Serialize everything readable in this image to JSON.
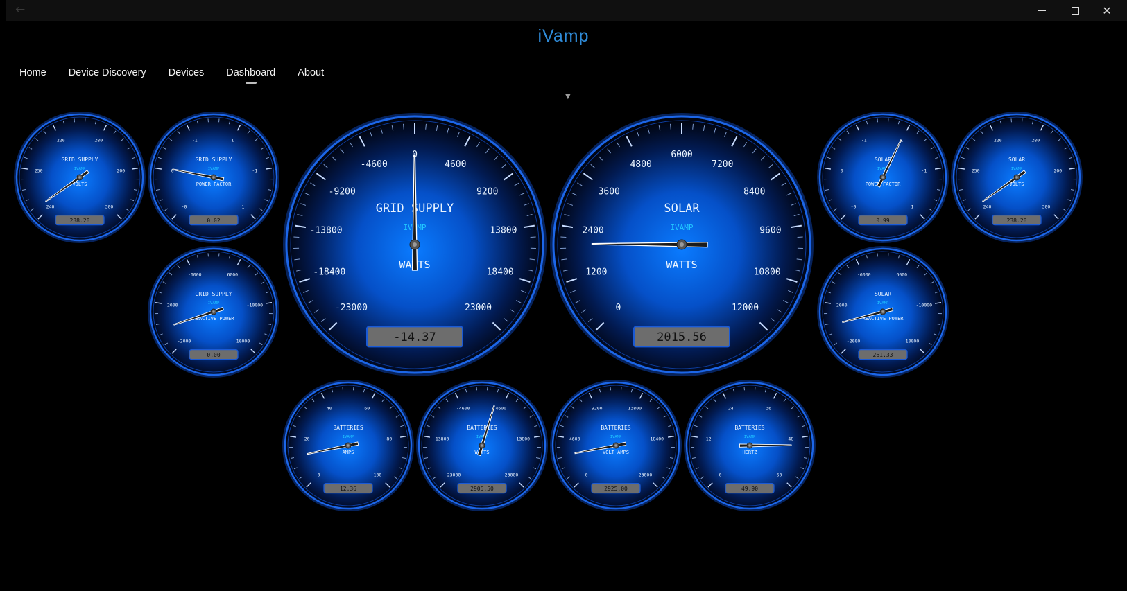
{
  "window": {
    "back_icon": "back-arrow-icon",
    "minimize_icon": "minimize-icon",
    "maximize_icon": "maximize-icon",
    "close_icon": "close-icon"
  },
  "app": {
    "title": "iVamp"
  },
  "nav": {
    "items": [
      {
        "label": "Home",
        "active": false
      },
      {
        "label": "Device Discovery",
        "active": false
      },
      {
        "label": "Devices",
        "active": false
      },
      {
        "label": "Dashboard",
        "active": true
      },
      {
        "label": "About",
        "active": false
      }
    ]
  },
  "expander": {
    "glyph": "▼",
    "icon": "chevron-down-icon"
  },
  "colors": {
    "accent": "#2f8bd8",
    "gauge_rim": "#1c66e8",
    "gauge_center": "#0a7bff",
    "brand": "#21c6ff"
  },
  "gauges": [
    {
      "id": "grid-voltage",
      "size": "small",
      "title": "GRID SUPPLY",
      "brand": "IVAMP",
      "unit": "VOLTS",
      "reading": "238.20",
      "value": 238.2,
      "scale": [
        {
          "label": "240",
          "value": 240
        },
        {
          "label": "250",
          "value": 250
        },
        {
          "label": "220",
          "value": 220
        },
        {
          "label": "280",
          "value": 280
        },
        {
          "label": "200",
          "value": 200
        },
        {
          "label": "300",
          "value": 300
        }
      ]
    },
    {
      "id": "grid-power-factor",
      "size": "small",
      "title": "GRID SUPPLY",
      "brand": "IVAMP",
      "unit": "POWER FACTOR",
      "reading": "0.02",
      "value": 0.02,
      "scale": [
        {
          "label": "-0",
          "value": -0.001
        },
        {
          "label": "0",
          "value": 0.001
        },
        {
          "label": "-1",
          "value": -1
        },
        {
          "label": "1",
          "value": 1
        },
        {
          "label": "-1",
          "value": -2
        },
        {
          "label": "1",
          "value": 2
        }
      ]
    },
    {
      "id": "grid-reactive-power",
      "size": "small",
      "title": "GRID SUPPLY",
      "brand": "IVAMP",
      "unit": "REACTIVE POWER",
      "reading": "0.00",
      "value": 0,
      "scale": [
        {
          "label": "-2000",
          "value": -2000
        },
        {
          "label": "2000",
          "value": 2000
        },
        {
          "label": "-6000",
          "value": -6000
        },
        {
          "label": "6000",
          "value": 6000
        },
        {
          "label": "-10000",
          "value": -10000
        },
        {
          "label": "10000",
          "value": 10000
        }
      ]
    },
    {
      "id": "grid-watts",
      "size": "large",
      "title": "GRID SUPPLY",
      "brand": "IVAMP",
      "unit": "WATTS",
      "reading": "-14.37",
      "value": -14.37,
      "scale": [
        {
          "label": "-23000",
          "value": -23000
        },
        {
          "label": "-18400",
          "value": -18400
        },
        {
          "label": "-13800",
          "value": -13800
        },
        {
          "label": "-9200",
          "value": -9200
        },
        {
          "label": "-4600",
          "value": -4600
        },
        {
          "label": "0",
          "value": 0
        },
        {
          "label": "4600",
          "value": 4600
        },
        {
          "label": "9200",
          "value": 9200
        },
        {
          "label": "13800",
          "value": 13800
        },
        {
          "label": "18400",
          "value": 18400
        },
        {
          "label": "23000",
          "value": 23000
        }
      ]
    },
    {
      "id": "solar-watts",
      "size": "large",
      "title": "SOLAR",
      "brand": "IVAMP",
      "unit": "WATTS",
      "reading": "2015.56",
      "value": 2015.56,
      "scale": [
        {
          "label": "0",
          "value": 0
        },
        {
          "label": "1200",
          "value": 1200
        },
        {
          "label": "2400",
          "value": 2400
        },
        {
          "label": "3600",
          "value": 3600
        },
        {
          "label": "4800",
          "value": 4800
        },
        {
          "label": "6000",
          "value": 6000
        },
        {
          "label": "7200",
          "value": 7200
        },
        {
          "label": "8400",
          "value": 8400
        },
        {
          "label": "9600",
          "value": 9600
        },
        {
          "label": "10800",
          "value": 10800
        },
        {
          "label": "12000",
          "value": 12000
        }
      ]
    },
    {
      "id": "solar-power-factor",
      "size": "small",
      "title": "SOLAR",
      "brand": "IVAMP",
      "unit": "POWER FACTOR",
      "reading": "0.99",
      "value": 0.99,
      "scale": [
        {
          "label": "-0",
          "value": -0.001
        },
        {
          "label": "0",
          "value": 0.001
        },
        {
          "label": "-1",
          "value": -1
        },
        {
          "label": "1",
          "value": 1
        },
        {
          "label": "-1",
          "value": -2
        },
        {
          "label": "1",
          "value": 2
        }
      ]
    },
    {
      "id": "solar-voltage",
      "size": "small",
      "title": "SOLAR",
      "brand": "IVAMP",
      "unit": "VOLTS",
      "reading": "238.20",
      "value": 238.2,
      "scale": [
        {
          "label": "240",
          "value": 240
        },
        {
          "label": "250",
          "value": 250
        },
        {
          "label": "220",
          "value": 220
        },
        {
          "label": "280",
          "value": 280
        },
        {
          "label": "200",
          "value": 200
        },
        {
          "label": "300",
          "value": 300
        }
      ]
    },
    {
      "id": "solar-reactive-power",
      "size": "small",
      "title": "SOLAR",
      "brand": "IVAMP",
      "unit": "REACTIVE POWER",
      "reading": "261.33",
      "value": 261.33,
      "scale": [
        {
          "label": "-2000",
          "value": -2000
        },
        {
          "label": "2000",
          "value": 2000
        },
        {
          "label": "-6000",
          "value": -6000
        },
        {
          "label": "6000",
          "value": 6000
        },
        {
          "label": "-10000",
          "value": -10000
        },
        {
          "label": "10000",
          "value": 10000
        }
      ]
    },
    {
      "id": "batteries-amps",
      "size": "small",
      "title": "BATTERIES",
      "brand": "IVAMP",
      "unit": "AMPS",
      "reading": "12.36",
      "value": 12.36,
      "scale": [
        {
          "label": "0",
          "value": 0
        },
        {
          "label": "20",
          "value": 20
        },
        {
          "label": "40",
          "value": 40
        },
        {
          "label": "60",
          "value": 60
        },
        {
          "label": "80",
          "value": 80
        },
        {
          "label": "100",
          "value": 100
        }
      ]
    },
    {
      "id": "batteries-watts",
      "size": "small",
      "title": "BATTERIES",
      "brand": "IVAMP",
      "unit": "WATTS",
      "reading": "2905.50",
      "value": 2905.5,
      "scale": [
        {
          "label": "-23000",
          "value": -23000
        },
        {
          "label": "-13800",
          "value": -13800
        },
        {
          "label": "-4600",
          "value": -4600
        },
        {
          "label": "4600",
          "value": 4600
        },
        {
          "label": "13800",
          "value": 13800
        },
        {
          "label": "23000",
          "value": 23000
        }
      ]
    },
    {
      "id": "batteries-volt-amps",
      "size": "small",
      "title": "BATTERIES",
      "brand": "IVAMP",
      "unit": "VOLT AMPS",
      "reading": "2925.00",
      "value": 2925,
      "scale": [
        {
          "label": "0",
          "value": 0
        },
        {
          "label": "4600",
          "value": 4600
        },
        {
          "label": "9200",
          "value": 9200
        },
        {
          "label": "13800",
          "value": 13800
        },
        {
          "label": "18400",
          "value": 18400
        },
        {
          "label": "23000",
          "value": 23000
        }
      ]
    },
    {
      "id": "batteries-hertz",
      "size": "small",
      "title": "BATTERIES",
      "brand": "IVAMP",
      "unit": "HERTZ",
      "reading": "49.90",
      "value": 49.9,
      "scale": [
        {
          "label": "0",
          "value": 0
        },
        {
          "label": "12",
          "value": 12
        },
        {
          "label": "24",
          "value": 24
        },
        {
          "label": "36",
          "value": 36
        },
        {
          "label": "48",
          "value": 48
        },
        {
          "label": "60",
          "value": 60
        }
      ]
    }
  ]
}
